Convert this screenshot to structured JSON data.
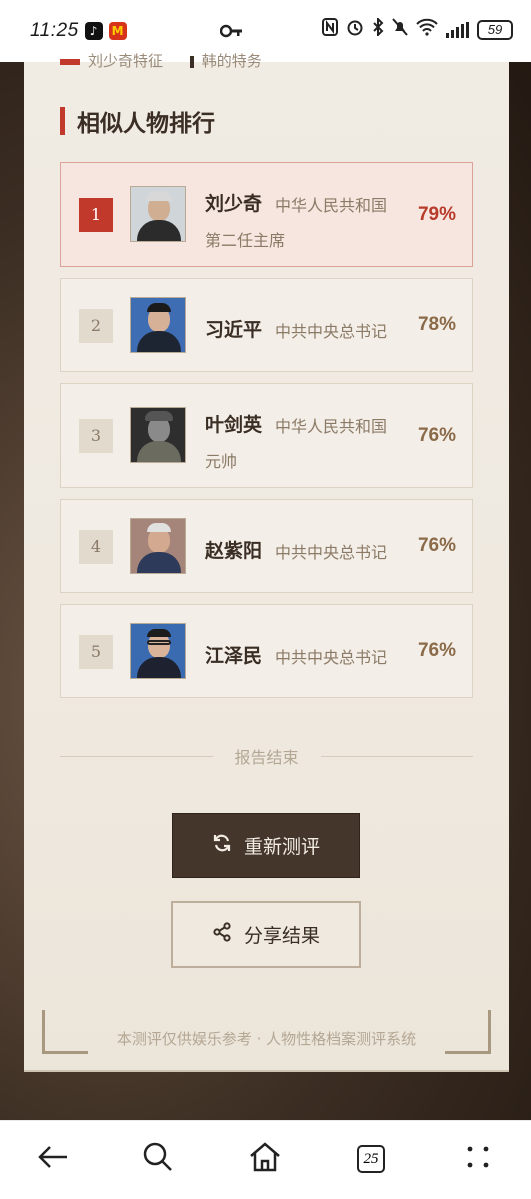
{
  "status_bar": {
    "time": "11:25",
    "battery": "59",
    "app_icons": [
      "tiktok-icon",
      "mcdonalds-icon"
    ],
    "right_icons": [
      "nfc-icon",
      "alarm-icon",
      "bluetooth-icon",
      "mute-icon",
      "wifi-icon",
      "signal-icon",
      "battery-icon"
    ]
  },
  "partial_top": {
    "left": "刘少奇特征",
    "right": "韩的特务"
  },
  "section": {
    "title": "相似人物排行"
  },
  "ranking": [
    {
      "rank": "1",
      "name": "刘少奇",
      "title_line1": "中华人民共和国",
      "title_line2": "第二任主席",
      "percent": "79%"
    },
    {
      "rank": "2",
      "name": "习近平",
      "title_line1": "中共中央总书记",
      "title_line2": "",
      "percent": "78%"
    },
    {
      "rank": "3",
      "name": "叶剑英",
      "title_line1": "中华人民共和国",
      "title_line2": "元帅",
      "percent": "76%"
    },
    {
      "rank": "4",
      "name": "赵紫阳",
      "title_line1": "中共中央总书记",
      "title_line2": "",
      "percent": "76%"
    },
    {
      "rank": "5",
      "name": "江泽民",
      "title_line1": "中共中央总书记",
      "title_line2": "",
      "percent": "76%"
    }
  ],
  "report_end": "报告结束",
  "buttons": {
    "restart": "重新测评",
    "share": "分享结果"
  },
  "footer": "本测评仅供娱乐参考 · 人物性格档案测评系统",
  "nav": {
    "tab_count": "25",
    "icons": [
      "back-icon",
      "search-icon",
      "home-icon",
      "tabs-icon",
      "menu-icon"
    ]
  },
  "colors": {
    "accent": "#c0392b",
    "dark_button": "#45362b",
    "card_bg": "#efe9e0"
  }
}
